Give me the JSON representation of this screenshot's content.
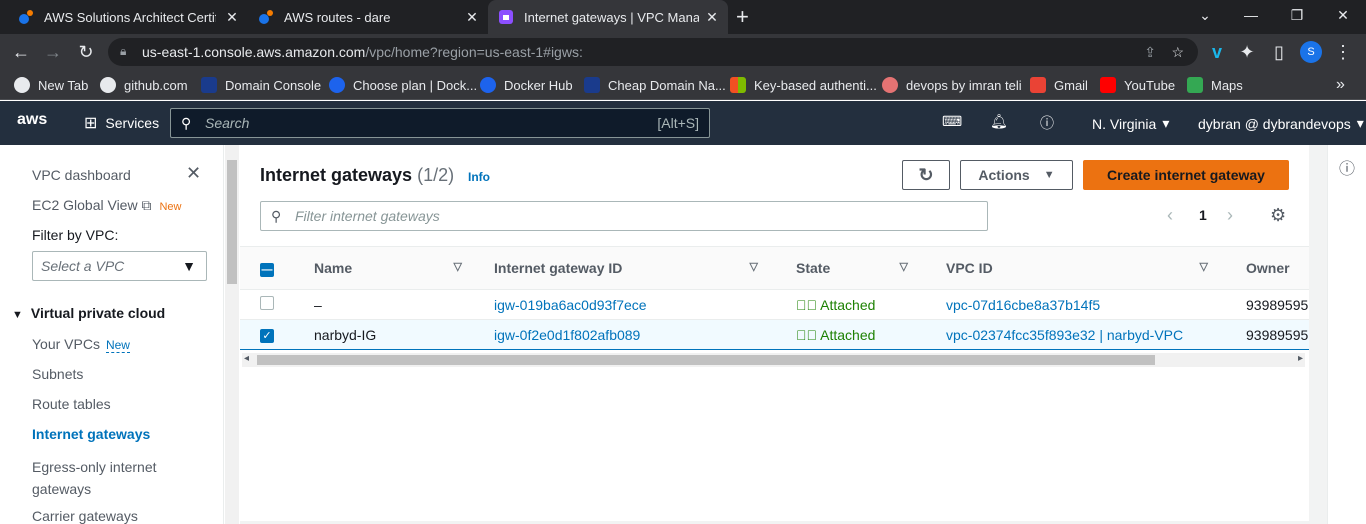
{
  "browser": {
    "tabs": [
      {
        "title": "AWS Solutions Architect Certifica",
        "favicon": "aws-devops-icon"
      },
      {
        "title": "AWS routes - dare",
        "favicon": "aws-devops-icon"
      },
      {
        "title": "Internet gateways | VPC Manage",
        "favicon": "vpc-icon"
      }
    ],
    "url_host": "us-east-1.console.aws.amazon.com",
    "url_path": "/vpc/home?region=us-east-1#igws:",
    "bookmarks": [
      {
        "label": "New Tab",
        "color": "#e8eaed"
      },
      {
        "label": "github.com",
        "color": "#e8eaed"
      },
      {
        "label": "Domain Console",
        "color": "#1a3b8c"
      },
      {
        "label": "Choose plan | Dock...",
        "color": "#1d63ed"
      },
      {
        "label": "Docker Hub",
        "color": "#1d63ed"
      },
      {
        "label": "Cheap Domain Na...",
        "color": "#1a3b8c"
      },
      {
        "label": "Key-based authenti...",
        "color": "#f25022"
      },
      {
        "label": "devops by imran teli",
        "color": "#e57373"
      },
      {
        "label": "Gmail",
        "color": "#ea4335"
      },
      {
        "label": "YouTube",
        "color": "#ff0000"
      },
      {
        "label": "Maps",
        "color": "#34a853"
      }
    ],
    "profile_initial": "S"
  },
  "aws": {
    "services_label": "Services",
    "search_placeholder": "Search",
    "search_shortcut": "[Alt+S]",
    "region": "N. Virginia",
    "account": "dybran @ dybrandevops"
  },
  "sidebar": {
    "dashboard": "VPC dashboard",
    "ec2_global": "EC2 Global View",
    "new_orange": "New",
    "filter_label": "Filter by VPC:",
    "filter_placeholder": "Select a VPC",
    "section": "Virtual private cloud",
    "items": [
      {
        "label": "Your VPCs",
        "badge": "New"
      },
      {
        "label": "Subnets"
      },
      {
        "label": "Route tables"
      },
      {
        "label": "Internet gateways"
      },
      {
        "label": "Egress-only internet gateways"
      },
      {
        "label": "Carrier gateways"
      }
    ]
  },
  "page": {
    "title": "Internet gateways",
    "count": "(1/2)",
    "info": "Info",
    "actions_label": "Actions",
    "create_label": "Create internet gateway",
    "filter_placeholder": "Filter internet gateways",
    "page_number": "1",
    "columns": [
      "Name",
      "Internet gateway ID",
      "State",
      "VPC ID",
      "Owner"
    ],
    "rows": [
      {
        "selected": false,
        "name": "–",
        "id": "igw-019ba6ac0d93f7ece",
        "state": "Attached",
        "vpc": "vpc-07d16cbe8a37b14f5",
        "owner": "93989595"
      },
      {
        "selected": true,
        "name": "narbyd-IG",
        "id": "igw-0f2e0d1f802afb089",
        "state": "Attached",
        "vpc": "vpc-02374fcc35f893e32 | narbyd-VPC",
        "owner": "93989595"
      }
    ]
  },
  "colors": {
    "aws_nav": "#232f3e",
    "link": "#0073bb",
    "primary": "#ec7211",
    "success": "#1d8102"
  }
}
